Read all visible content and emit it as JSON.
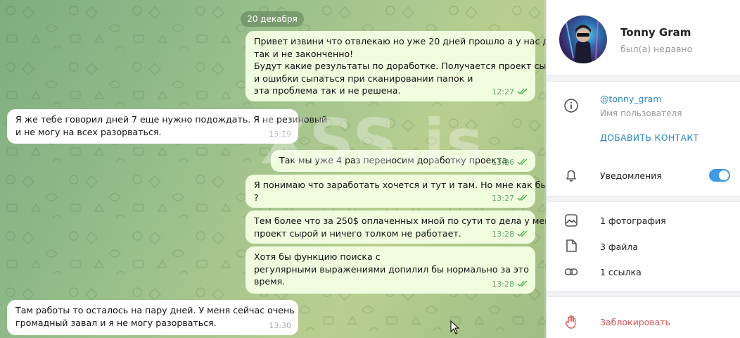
{
  "chat": {
    "date": "20 декабря",
    "watermark": "XSS.is",
    "messages": [
      {
        "direction": "out",
        "lines": [
          "Привет извини что отвлекаю но уже 20 дней прошло а у нас дело",
          "так и не законченно!",
          "Будут какие результаты по доработке. Получается проект сырой",
          "и ошибки сыпаться при сканировании папок и",
          "эта проблема так и не решена."
        ],
        "time": "12:27",
        "read": true
      },
      {
        "direction": "in",
        "lines": [
          "Я же тебе говорил дней 7 еще нужно подождать. Я не резиновый",
          "и не могу на всех разорваться."
        ],
        "time": "13:19"
      },
      {
        "direction": "out",
        "lines": [
          "Так мы уже 4 раз переносим доработку проекта."
        ],
        "time": "13:26",
        "read": true
      },
      {
        "direction": "out",
        "lines": [
          "Я понимаю что заработать хочется и тут и там. Но мне как быть",
          "?"
        ],
        "time": "13:27",
        "read": true
      },
      {
        "direction": "out",
        "lines": [
          "Тем более что за 250$ оплаченных мной по сути то дела у меня",
          "проект сырой и ничего толком не работает."
        ],
        "time": "13:28",
        "read": true
      },
      {
        "direction": "out",
        "lines": [
          "Хотя бы функцию поиска с",
          "регулярными выражениями допилил бы нормально за это",
          "время."
        ],
        "time": "13:28",
        "read": true
      },
      {
        "direction": "in",
        "lines": [
          "Там работы то осталось на пару дней. У меня сейчас очень",
          "громадный завал и я не могу разорваться."
        ],
        "time": "13:30"
      }
    ]
  },
  "profile": {
    "name": "Tonny Gram",
    "status": "был(а) недавно",
    "username": "@tonny_gram",
    "username_label": "Имя пользователя",
    "add_contact": "ДОБАВИТЬ КОНТАКТ",
    "notifications_label": "Уведомления",
    "notifications_on": true,
    "media": [
      {
        "icon": "photo-icon",
        "label": "1 фотография"
      },
      {
        "icon": "file-icon",
        "label": "3 файла"
      },
      {
        "icon": "link-icon",
        "label": "1 ссылка"
      }
    ],
    "block_label": "Заблокировать"
  },
  "colors": {
    "outgoing_bubble": "#effdde",
    "incoming_bubble": "#ffffff",
    "link": "#2a86c6",
    "danger": "#d9534f",
    "toggle": "#3d9ae3"
  }
}
